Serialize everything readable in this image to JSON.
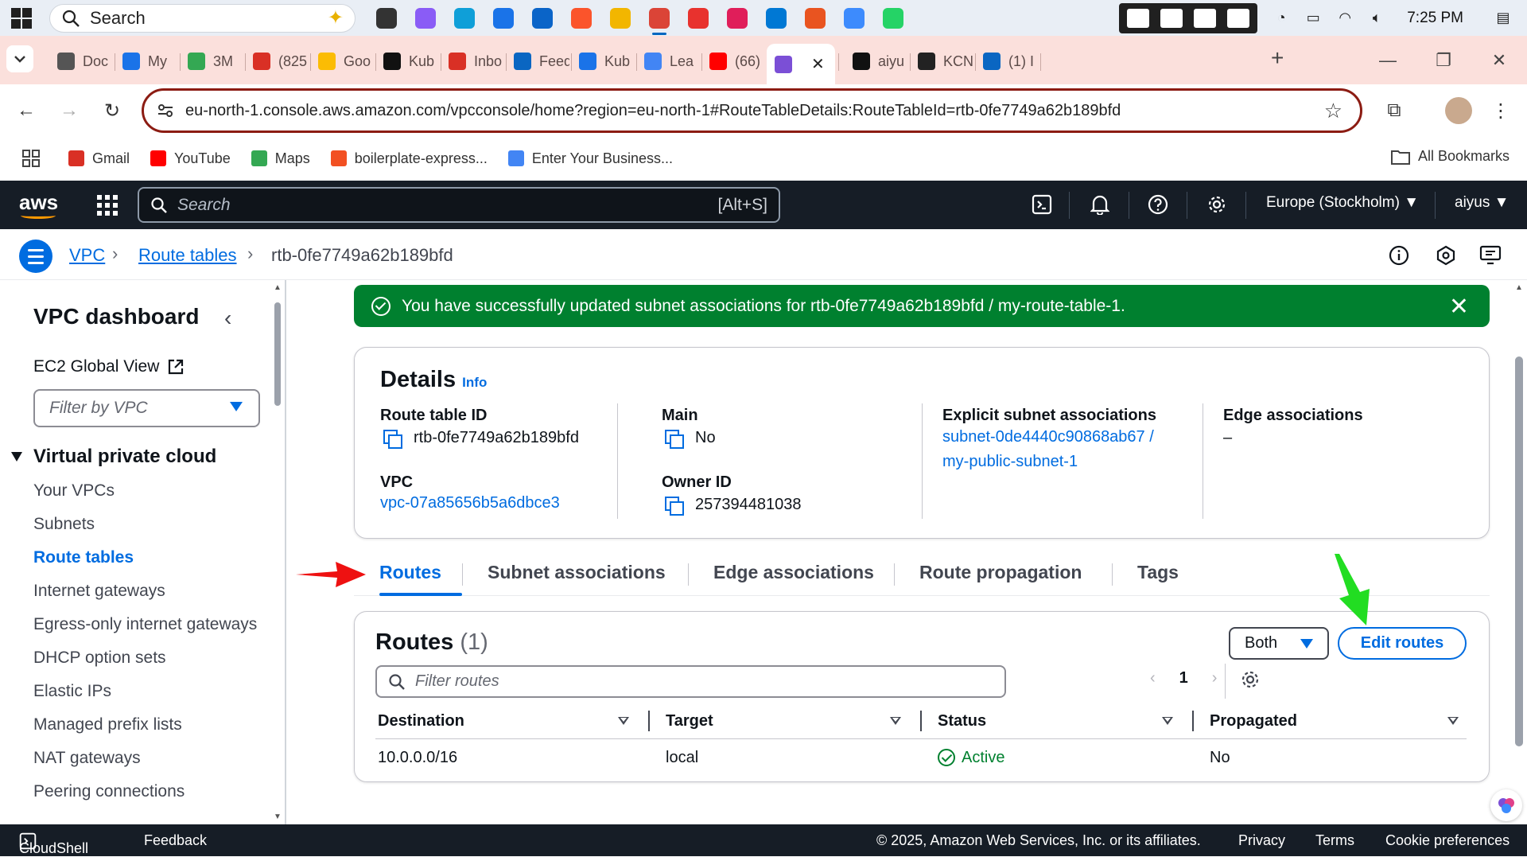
{
  "taskbar": {
    "search_label": "Search",
    "clock": "7:25 PM",
    "apps": [
      {
        "icon": "task-view-icon",
        "color": "#333333"
      },
      {
        "icon": "copilot-icon",
        "color": "#8a5cf6"
      },
      {
        "icon": "edge-icon",
        "color": "#0f9fd8"
      },
      {
        "icon": "store-icon",
        "color": "#1a73e8"
      },
      {
        "icon": "outlook-icon",
        "color": "#0a64c8"
      },
      {
        "icon": "brave-icon",
        "color": "#fb542b"
      },
      {
        "icon": "file-explorer-icon",
        "color": "#f2b600"
      },
      {
        "icon": "chrome-icon",
        "color": "#db4437"
      },
      {
        "icon": "wps-icon",
        "color": "#e8322e"
      },
      {
        "icon": "slack-icon",
        "color": "#e01e5a"
      },
      {
        "icon": "vscode-icon",
        "color": "#0078d4"
      },
      {
        "icon": "ubuntu-icon",
        "color": "#e95420"
      },
      {
        "icon": "app-blue-icon",
        "color": "#3d8bfd"
      },
      {
        "icon": "whatsapp-icon",
        "color": "#25d366"
      }
    ]
  },
  "browser": {
    "tabs": [
      {
        "label": "Doc",
        "color": "#555555"
      },
      {
        "label": "My",
        "color": "#1a73e8"
      },
      {
        "label": "3M",
        "color": "#34a853"
      },
      {
        "label": "(825",
        "color": "#d93025"
      },
      {
        "label": "Goo",
        "color": "#fbbc04"
      },
      {
        "label": "Kub",
        "color": "#111111"
      },
      {
        "label": "Inbo",
        "color": "#d93025"
      },
      {
        "label": "Feed",
        "color": "#0a66c2"
      },
      {
        "label": "Kub",
        "color": "#1a73e8"
      },
      {
        "label": "Lea",
        "color": "#4285f4"
      },
      {
        "label": "(66)",
        "color": "#ff0000"
      },
      {
        "label": "",
        "color": "#7b4fd6"
      },
      {
        "label": "aiyu",
        "color": "#111111"
      },
      {
        "label": "KCN",
        "color": "#222222"
      },
      {
        "label": "(1) I",
        "color": "#0a66c2"
      }
    ],
    "url": "eu-north-1.console.aws.amazon.com/vpcconsole/home?region=eu-north-1#RouteTableDetails:RouteTableId=rtb-0fe7749a62b189bfd",
    "bookmarks": [
      {
        "label": "Gmail",
        "color": "#d93025"
      },
      {
        "label": "YouTube",
        "color": "#ff0000"
      },
      {
        "label": "Maps",
        "color": "#34a853"
      },
      {
        "label": "boilerplate-express...",
        "color": "#f25022"
      },
      {
        "label": "Enter Your Business...",
        "color": "#4285f4"
      }
    ],
    "all_bookmarks": "All Bookmarks"
  },
  "aws_header": {
    "logo": "aws",
    "search_placeholder": "Search",
    "search_shortcut": "[Alt+S]",
    "region": "Europe (Stockholm)",
    "user": "aiyus"
  },
  "breadcrumb": {
    "items": [
      "VPC",
      "Route tables",
      "rtb-0fe7749a62b189bfd"
    ]
  },
  "sidebar": {
    "title": "VPC dashboard",
    "ec2_global_view": "EC2 Global View",
    "filter_placeholder": "Filter by VPC",
    "section": "Virtual private cloud",
    "items": [
      {
        "label": "Your VPCs"
      },
      {
        "label": "Subnets"
      },
      {
        "label": "Route tables"
      },
      {
        "label": "Internet gateways"
      },
      {
        "label": "Egress-only internet gateways"
      },
      {
        "label": "DHCP option sets"
      },
      {
        "label": "Elastic IPs"
      },
      {
        "label": "Managed prefix lists"
      },
      {
        "label": "NAT gateways"
      },
      {
        "label": "Peering connections"
      }
    ]
  },
  "flash": {
    "message": "You have successfully updated subnet associations for rtb-0fe7749a62b189bfd / my-route-table-1."
  },
  "details": {
    "title": "Details",
    "info": "Info",
    "route_table_id_label": "Route table ID",
    "route_table_id": "rtb-0fe7749a62b189bfd",
    "main_label": "Main",
    "main": "No",
    "explicit_label": "Explicit subnet associations",
    "explicit_line1": "subnet-0de4440c90868ab67 /",
    "explicit_line2": "my-public-subnet-1",
    "edge_label": "Edge associations",
    "edge": "–",
    "vpc_label": "VPC",
    "vpc": "vpc-07a85656b5a6dbce3",
    "owner_label": "Owner ID",
    "owner": "257394481038"
  },
  "tabs": [
    "Routes",
    "Subnet associations",
    "Edge associations",
    "Route propagation",
    "Tags"
  ],
  "routes": {
    "title": "Routes",
    "count": "(1)",
    "filter_select": "Both",
    "edit_button": "Edit routes",
    "filter_placeholder": "Filter routes",
    "page": "1",
    "columns": [
      "Destination",
      "Target",
      "Status",
      "Propagated"
    ],
    "rows": [
      {
        "destination": "10.0.0.0/16",
        "target": "local",
        "status": "Active",
        "propagated": "No"
      }
    ]
  },
  "footer": {
    "cloudshell": "CloudShell",
    "feedback": "Feedback",
    "copyright": "© 2025, Amazon Web Services, Inc. or its affiliates.",
    "privacy": "Privacy",
    "terms": "Terms",
    "cookies": "Cookie preferences"
  },
  "colors": {
    "accent": "#006ce0",
    "success": "#00802f",
    "header_bg": "#161d26",
    "annotation_red": "#ee1111",
    "annotation_green": "#22dd22"
  }
}
